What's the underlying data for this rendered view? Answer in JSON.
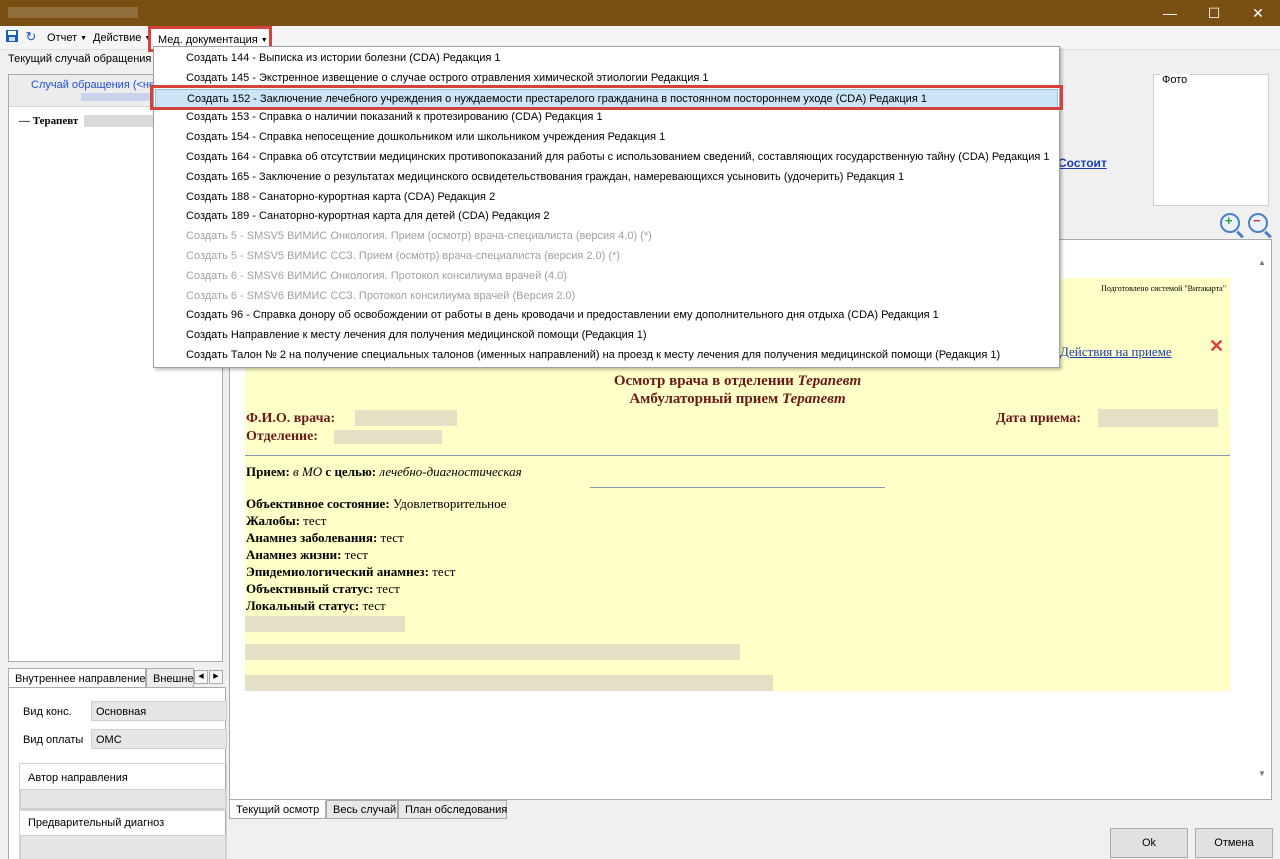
{
  "window": {
    "controls": [
      "—",
      "☐",
      "✕"
    ]
  },
  "toolbar": {
    "report_label": "Отчет",
    "action_label": "Действие",
    "meddoc_label": "Мед. документация"
  },
  "left": {
    "current_case_label": "Текущий случай обращения",
    "tree_header": "Случай обращения (<не",
    "tree_node": "Терапевт",
    "tabs": [
      "Внутреннее направление",
      "Внешне"
    ],
    "kind_consult_label": "Вид конс.",
    "kind_consult_value": "Основная",
    "payment_label": "Вид оплаты",
    "payment_value": "ОМС",
    "author_label": "Автор направления",
    "diagnosis_label": "Предварительный диагноз"
  },
  "right": {
    "photo_label": "Фото",
    "state_link": "Состоит"
  },
  "document": {
    "prepared": "Подготовлено системой \"Витакарта\"",
    "actions_link": "Действия на приеме",
    "title_line1_prefix": "Осмотр врача в отделении ",
    "title_line1_italic": "Терапевт",
    "title_line2_prefix": "Амбулаторный прием ",
    "title_line2_italic": "Терапевт",
    "doctor_label": "Ф.И.О. врача:",
    "department_label": "Отделение:",
    "date_label": "Дата приема:",
    "reception_label": "Прием:",
    "reception_place": "в МО",
    "reception_goal_label": "с целью:",
    "reception_goal": "лечебно-диагностическая",
    "fields": [
      {
        "label": "Объективное состояние:",
        "value": "Удовлетворительное"
      },
      {
        "label": "Жалобы:",
        "value": "тест"
      },
      {
        "label": "Анамнез заболевания:",
        "value": "тест"
      },
      {
        "label": "Анамнез жизни:",
        "value": "тест"
      },
      {
        "label": "Эпидемиологический анамнез:",
        "value": "тест"
      },
      {
        "label": "Объективный статус:",
        "value": "тест"
      },
      {
        "label": "Локальный статус:",
        "value": "тест"
      }
    ]
  },
  "bottom_tabs": [
    "Текущий осмотр",
    "Весь случай",
    "План обследования"
  ],
  "buttons": {
    "ok": "Ok",
    "cancel": "Отмена"
  },
  "menu": {
    "selected_index": 2,
    "items": [
      {
        "label": "Создать 144 -  Выписка из истории болезни (CDA) Редакция 1",
        "disabled": false
      },
      {
        "label": "Создать 145 - Экстренное извещение о случае острого отравления химической этиологии Редакция 1",
        "disabled": false
      },
      {
        "label": "Создать 152 - Заключение лечебного учреждения о нуждаемости престарелого гражданина в постоянном постороннем уходе (CDA) Редакция 1",
        "disabled": false
      },
      {
        "label": "Создать 153 - Справка о наличии показаний к протезированию (CDA) Редакция 1",
        "disabled": false
      },
      {
        "label": "Создать 154 - Справка непосещение дошкольником или школьником учреждения Редакция 1",
        "disabled": false
      },
      {
        "label": "Создать 164 - Справка об отсутствии медицинских противопоказаний для работы с использованием сведений, составляющих государственную тайну (CDA) Редакция 1",
        "disabled": false
      },
      {
        "label": "Создать 165 - Заключение о результатах медицинского освидетельствования граждан, намеревающихся усыновить (удочерить) Редакция 1",
        "disabled": false
      },
      {
        "label": "Создать 188 - Санаторно-курортная карта (CDA) Редакция 2",
        "disabled": false
      },
      {
        "label": "Создать 189 - Санаторно-курортная карта для детей (CDA) Редакция 2",
        "disabled": false
      },
      {
        "label": "Создать 5 - SMSV5 ВИМИС Онкология. Прием (осмотр) врача-специалиста  (версия 4.0) (*)",
        "disabled": true
      },
      {
        "label": "Создать 5 - SMSV5 ВИМИС ССЗ. Прием (осмотр) врача-специалиста (версия 2.0) (*)",
        "disabled": true
      },
      {
        "label": "Создать 6 - SMSV6 ВИМИС Онкология. Протокол консилиума врачей (4.0)",
        "disabled": true
      },
      {
        "label": "Создать 6 - SMSV6 ВИМИС ССЗ. Протокол консилиума врачей (Версия 2.0)",
        "disabled": true
      },
      {
        "label": "Создать 96 - Справка донору об освобождении от работы в день кроводачи и предоставлении ему дополнительного дня отдыха (CDA) Редакция 1",
        "disabled": false
      },
      {
        "label": "Создать Направление к месту лечения для получения медицинской помощи (Редакция 1)",
        "disabled": false
      },
      {
        "label": "Создать Талон № 2 на получение специальных талонов (именных направлений) на проезд к месту лечения для получения медицинской помощи (Редакция 1)",
        "disabled": false
      }
    ]
  }
}
